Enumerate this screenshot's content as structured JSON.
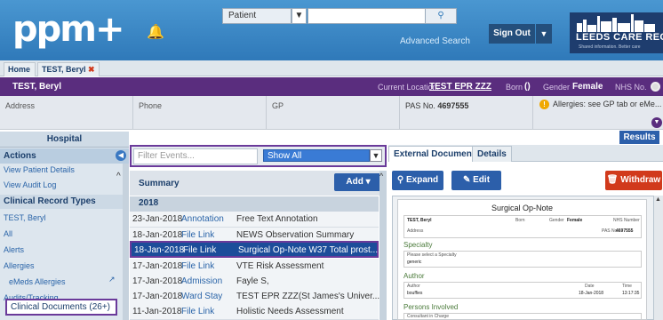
{
  "header": {
    "logo": "ppm+",
    "patient_select": "Patient",
    "advanced_search": "Advanced Search",
    "sign_out": "Sign Out",
    "brand_title": "LEEDS CARE REC",
    "brand_subtitle": "Shared information. Better care"
  },
  "tabs": {
    "home": "Home",
    "patient_tab": "TEST, Beryl"
  },
  "patient_bar": {
    "name": "TEST, Beryl",
    "location_label": "Current Location:",
    "location": "TEST EPR ZZZ",
    "born_label": "Born",
    "born": "()",
    "gender_label": "Gender",
    "gender": "Female",
    "nhs_label": "NHS No."
  },
  "demographics": {
    "address": "Address",
    "phone": "Phone",
    "gp": "GP",
    "pas_label": "PAS No.",
    "pas": "4697555",
    "allergies": "Allergies: see GP tab or eMe..."
  },
  "sidebar": {
    "hospital": "Hospital",
    "actions": "Actions",
    "items": [
      {
        "label": "View Patient Details"
      },
      {
        "label": "View Audit Log"
      }
    ],
    "section": "Clinical Record Types",
    "records": [
      {
        "label": "TEST, Beryl"
      },
      {
        "label": "All"
      },
      {
        "label": "Alerts"
      },
      {
        "label": "Allergies"
      },
      {
        "label": "eMeds Allergies"
      },
      {
        "label": "Audits/Tracking"
      }
    ],
    "selected": "Clinical Documents (26+)"
  },
  "events": {
    "filter_placeholder": "Filter Events...",
    "show_all": "Show All",
    "summary": "Summary",
    "add": "Add ▾",
    "year": "2018",
    "rows": [
      {
        "date": "23-Jan-2018",
        "type": "Annotation",
        "desc": "Free Text Annotation"
      },
      {
        "date": "18-Jan-2018",
        "type": "File Link",
        "desc": "NEWS Observation Summary"
      },
      {
        "date": "18-Jan-2018",
        "type": "File Link",
        "desc": "Surgical Op-Note W37 Total prost..."
      },
      {
        "date": "17-Jan-2018",
        "type": "File Link",
        "desc": "VTE Risk Assessment"
      },
      {
        "date": "17-Jan-2018",
        "type": "Admission",
        "desc": "Fayle S,"
      },
      {
        "date": "17-Jan-2018",
        "type": "Ward Stay",
        "desc": "TEST EPR ZZZ(St James's Univer..."
      },
      {
        "date": "11-Jan-2018",
        "type": "File Link",
        "desc": "Holistic Needs Assessment"
      }
    ]
  },
  "document_panel": {
    "tab_external": "External Document",
    "tab_details": "Details",
    "results": "Results",
    "expand": "Expand",
    "edit": "Edit",
    "withdraw": "Withdraw",
    "doc": {
      "title": "Surgical Op-Note",
      "patient": "TEST, Beryl",
      "born_label": "Born",
      "gender_label": "Gender",
      "gender": "Female",
      "nhs_label": "NHS Number",
      "address_label": "Address",
      "pas_label": "PAS No.",
      "pas": "4697555",
      "specialty_heading": "Specialty",
      "specialty_hint": "Please select a Specialty",
      "specialty_value": "generic",
      "author_heading": "Author",
      "author_label": "Author",
      "author": "bouffies",
      "date_label": "Date",
      "date": "18-Jan-2018",
      "time_label": "Time",
      "time": "13:17:35",
      "persons_heading": "Persons Involved",
      "consultant_label": "Consultant in Charge"
    }
  }
}
